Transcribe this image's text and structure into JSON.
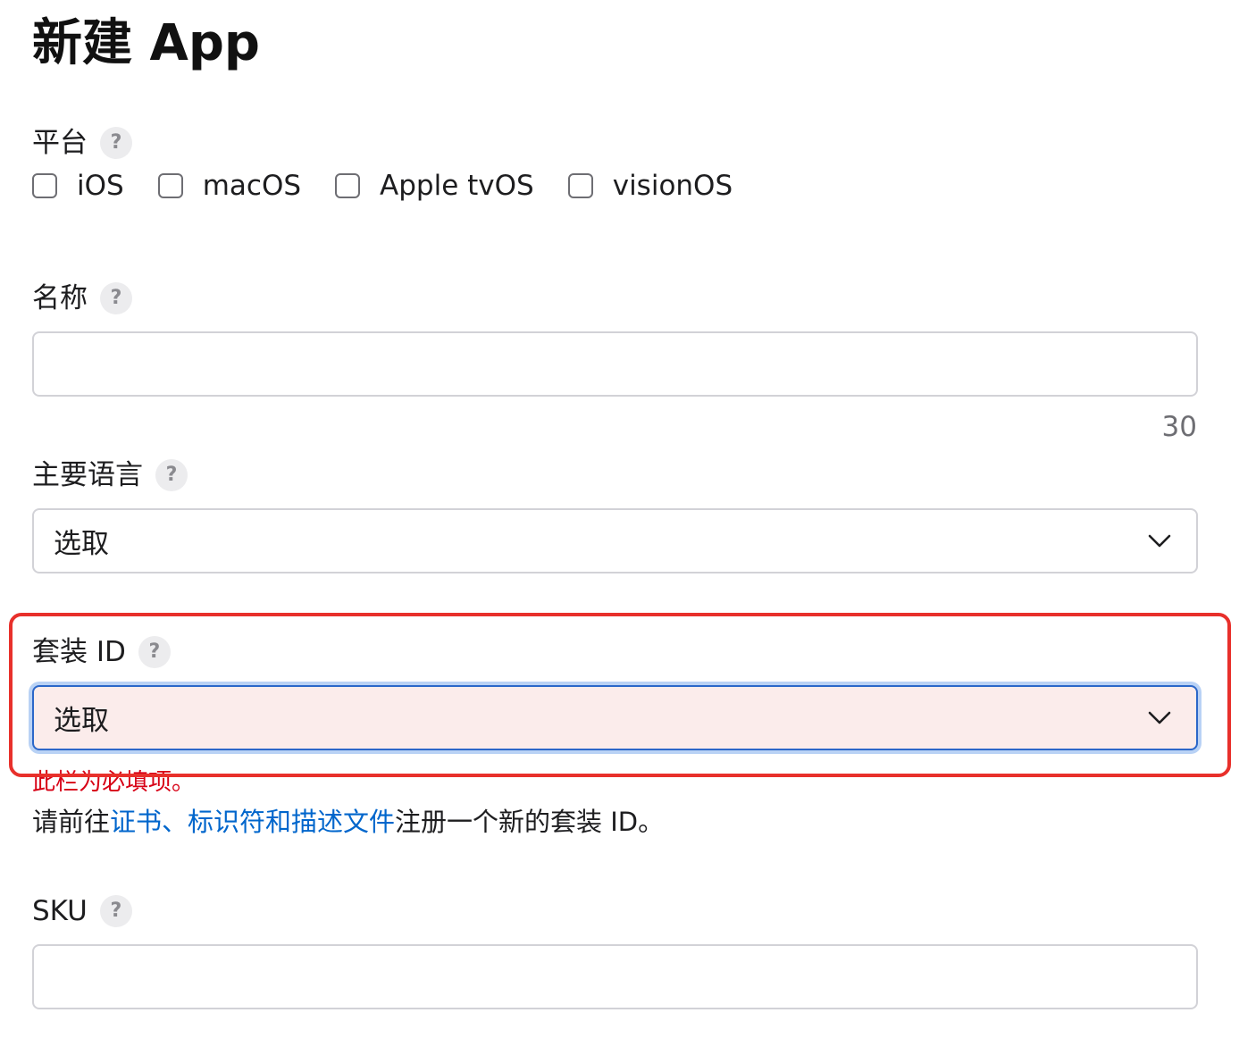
{
  "page": {
    "title": "新建 App"
  },
  "platform": {
    "label": "平台",
    "help": "?",
    "options": [
      {
        "label": "iOS",
        "checked": false
      },
      {
        "label": "macOS",
        "checked": false
      },
      {
        "label": "Apple tvOS",
        "checked": false
      },
      {
        "label": "visionOS",
        "checked": false
      }
    ]
  },
  "name": {
    "label": "名称",
    "help": "?",
    "value": "",
    "remaining": "30"
  },
  "primary_language": {
    "label": "主要语言",
    "help": "?",
    "selected": "选取"
  },
  "bundle_id": {
    "label": "套装 ID",
    "help": "?",
    "selected": "选取",
    "error": "此栏为必填项。",
    "hint_prefix": "请前往",
    "hint_link": "证书、标识符和描述文件",
    "hint_suffix": "注册一个新的套装 ID。"
  },
  "sku": {
    "label": "SKU",
    "help": "?",
    "value": ""
  },
  "colors": {
    "annotation_box": "#e8302b",
    "error_text": "#d70015",
    "link": "#0066cc",
    "error_field_bg": "#fbeceb",
    "focus_border": "#2b67c9"
  }
}
